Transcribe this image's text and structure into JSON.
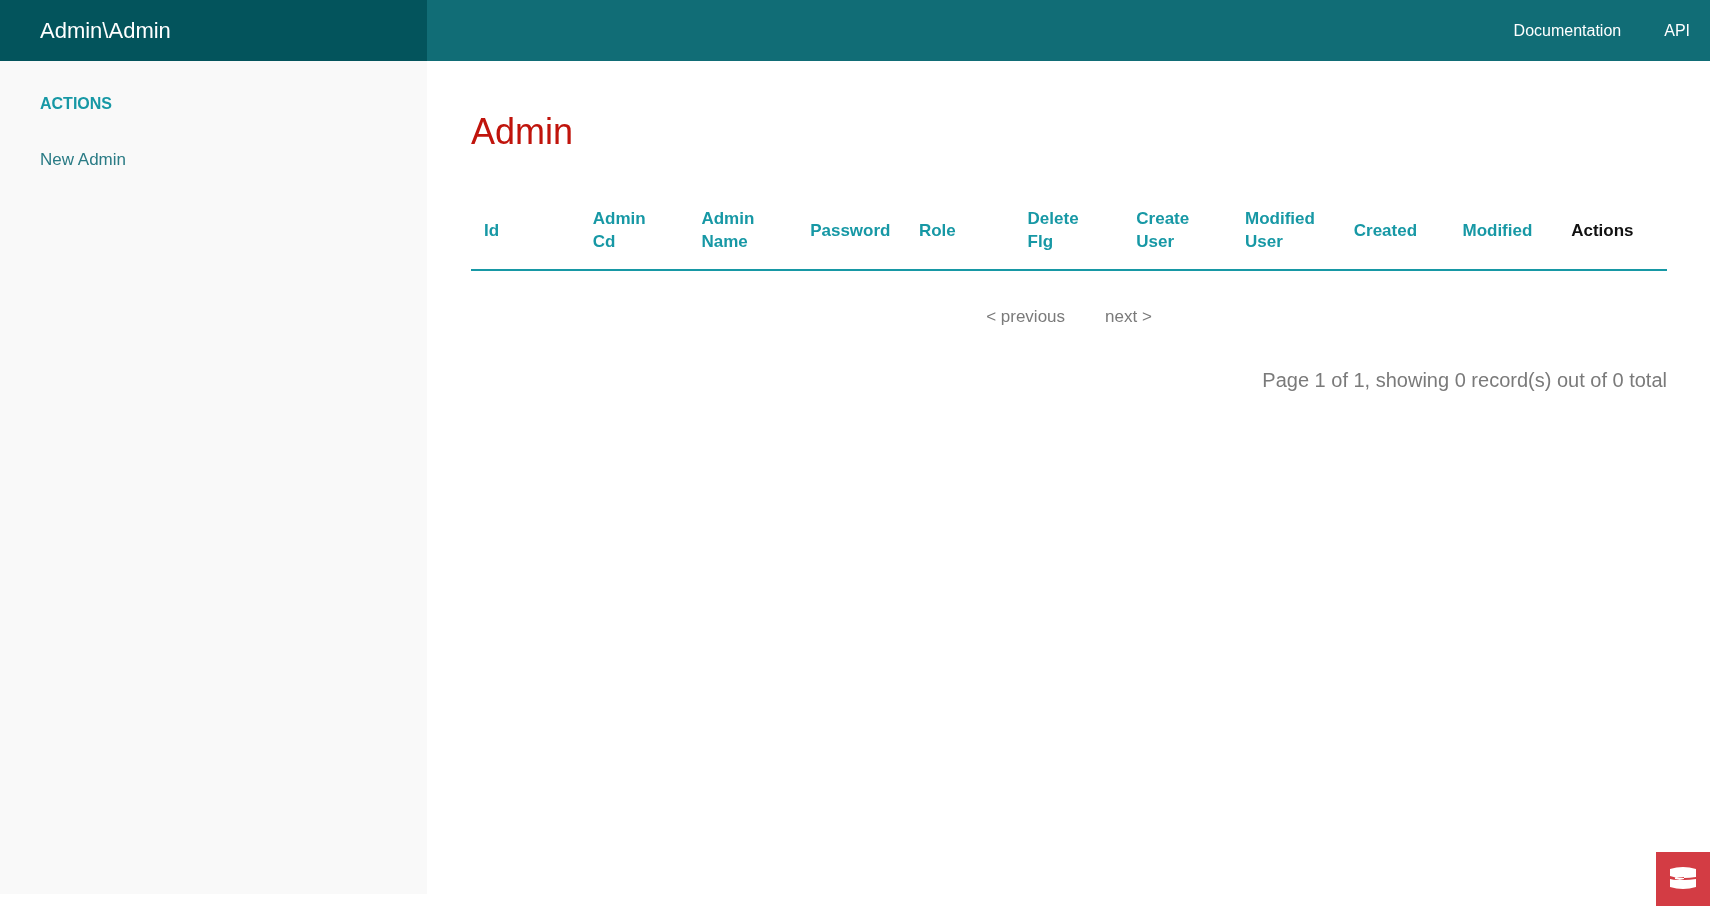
{
  "top_bar": {
    "title": "Admin\\Admin",
    "links": [
      "Documentation",
      "API"
    ]
  },
  "sidebar": {
    "heading": "ACTIONS",
    "items": [
      "New Admin"
    ]
  },
  "page": {
    "title": "Admin"
  },
  "table": {
    "columns": [
      {
        "label": "Id",
        "sortable": true
      },
      {
        "label": "Admin Cd",
        "sortable": true
      },
      {
        "label": "Admin Name",
        "sortable": true
      },
      {
        "label": "Password",
        "sortable": true
      },
      {
        "label": "Role",
        "sortable": true
      },
      {
        "label": "Delete Flg",
        "sortable": true
      },
      {
        "label": "Create User",
        "sortable": true
      },
      {
        "label": "Modified User",
        "sortable": true
      },
      {
        "label": "Created",
        "sortable": true
      },
      {
        "label": "Modified",
        "sortable": true
      },
      {
        "label": "Actions",
        "sortable": false
      }
    ]
  },
  "pagination": {
    "previous": "< previous",
    "next": "next >",
    "counter": "Page 1 of 1, showing 0 record(s) out of 0 total"
  }
}
